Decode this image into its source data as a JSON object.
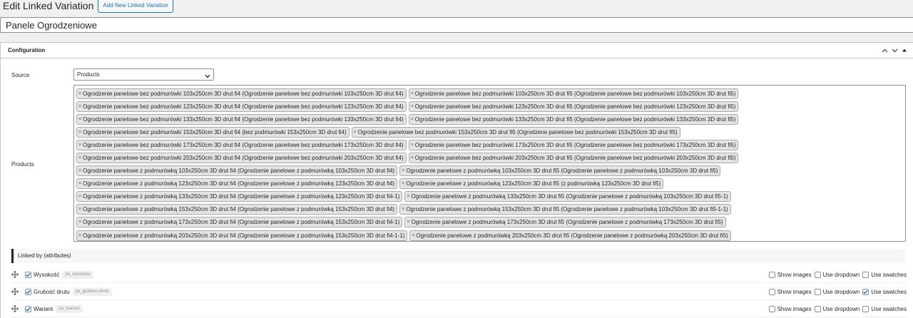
{
  "page": {
    "title": "Edit Linked Variation",
    "add_new_label": "Add New Linked Variation",
    "post_title": "Panele Ogrodzeniowe"
  },
  "config": {
    "title": "Configuration",
    "source_label": "Source",
    "source_value": "Products",
    "products_label": "Products",
    "linked_by_label": "Linked by (attributes)"
  },
  "products": [
    [
      "Ogrodzenie panelowe bez podmurówki 103x250cm 3D drut fi4 (Ogrodzenie panelowe bez podmurówki 103x250cm 3D drut fi4)",
      "Ogrodzenie panelowe bez podmurówki 103x250cm 3D drut fi5 (Ogrodzenie panelowe bez podmurówki 103x250cm 3D drut fi5)"
    ],
    [
      "Ogrodzenie panelowe bez podmurówki 123x250cm 3D drut fi4 (Ogrodzenie panelowe bez podmurówki 123x250cm 3D drut fi4)",
      "Ogrodzenie panelowe bez podmurówki 123x250cm 3D drut fi5 (Ogrodzenie panelowe bez podmurówki 123x250cm 3D drut fi5)"
    ],
    [
      "Ogrodzenie panelowe bez podmurówki 133x250cm 3D drut fi4 (Ogrodzenie panelowe bez podmurówki 133x250cm 3D drut fi4)",
      "Ogrodzenie panelowe bez podmurówki 133x250cm 3D drut fi5 (Ogrodzenie panelowe bez podmurówki 133x250cm 3D drut fi5)"
    ],
    [
      "Ogrodzenie panelowe bez podmurówki 153x250cm 3D drut fi4 (bez podmurówki 153x250cm 3D drut fi4)",
      "Ogrodzenie panelowe bez podmurówki 153x250cm 3D drut fi5 (Ogrodzene panelowe bez podmurówki 153x250cm 3D drut fi5)"
    ],
    [
      "Ogrodzenie panelowe bez podmurówki 173x250cm 3D drut fi4 (Ogrodzenie panelowe bez podmurówki 173x250cm 3D drut fi4)",
      "Ogrodzenie panelowe bez podmurówki 173x250cm 3D drut fi5 (Ogrodzenie panelowe bez podmurówki 173x250cm 3D drut fi5)"
    ],
    [
      "Ogrodzenie panelowe bez podmurówki 203x250cm 3D drut fi4 (Ogrodzenie panelowe bez podmurówki 203x250cm 3D drut fi4)",
      "Ogrodzenie panelowe bez podmurówki 203x250cm 3D drut fi5 (Ogrodzenie panelowe bez podmurówki 203x250cm 3D drut fi5)"
    ],
    [
      "Ogrodzenie panelowe z podmurówką 103x250cm 3D drut fi4 (Ogrodzenie panelowe z podmurówką 103x250cm 3D drut fi4)",
      "Ogrodzenie panelowe z podmurówką 103x250cm 3D drut fi5 (Ogrodzenie panelowe z podmurówką 103x250cm 3D drut fi5)"
    ],
    [
      "Ogrodzenie panelowe z podmurówką 123x250cm 3D drut fi4 (Ogrodzenie panelowe z podmurówką 123x250cm 3D drut fi4)",
      "Ogrodzenie panelowe z podmurówką 123x250cm 3D drut fi5 (z podmurówką 123x250cm 3D drut fi5)"
    ],
    [
      "Ogrodzenie panelowe z podmurówką 133x250cm 3D drut fi4 (Ogrodzenie panelowe z podmurówką 123x250cm 3D drut fi4-1)",
      "Ogrodzenie panelowe z podmurówką 133x250cm 3D drut fi5 (Ogrodzenie panelowe z podmurówką 103x250cm 3D drut fi5-1)"
    ],
    [
      "Ogrodzenie panelowe z podmurówką 153x250cm 3D drut fi4 (Ogrodzenie panelowe z podmurówką 153x250cm 3D drut fi4)",
      "Ogrodzenie panelowe z podmurówką 153x250cm 3D drut fi5 (Ogrodzenie panelowe z podmurówką 103x250cm 3D drut fi5-1-1)"
    ],
    [
      "Ogrodzenie panelowe z podmurówką 173x250cm 3D drut fi4 (Ogrodzenie panelowe z podmurówką 153x250cm 3D drut fi4-1)",
      "Ogrodzenie panelowe z podmurówką 173x250cm 3D drut fi5 (Ogrodzenie panelowe z podmurówką 173x250cm 3D drut fi5)"
    ],
    [
      "Ogrodzenie panelowe z podmurówką 203x250cm 3D drut fi4 (Ogrodzenie panelowe z podmurówką 153x250cm 3D drut fi4-1-1)",
      "Ogrodzenie panelowe z podmurówką 203x250cm 3D drut fi5 (Ogrodzenie panelowe z podmurówką 203x250cm 3D drut fi5)"
    ]
  ],
  "attributes": [
    {
      "name": "Wysokość",
      "slug": "pa_wysokosc",
      "checked": true,
      "show_images": false,
      "use_dropdown": false,
      "use_swatches": false
    },
    {
      "name": "Grubość drutu",
      "slug": "pa_grubosc-drutu",
      "checked": true,
      "show_images": false,
      "use_dropdown": false,
      "use_swatches": true
    },
    {
      "name": "Wariant",
      "slug": "pa_wariant",
      "checked": true,
      "show_images": false,
      "use_dropdown": false,
      "use_swatches": false
    }
  ],
  "options": {
    "show_images": "Show images",
    "use_dropdown": "Use dropdown",
    "use_swatches": "Use swatches"
  },
  "colors": {
    "accent": "#2271b1",
    "check": "#2271b1",
    "chip_bg": "#e4e4e4"
  }
}
